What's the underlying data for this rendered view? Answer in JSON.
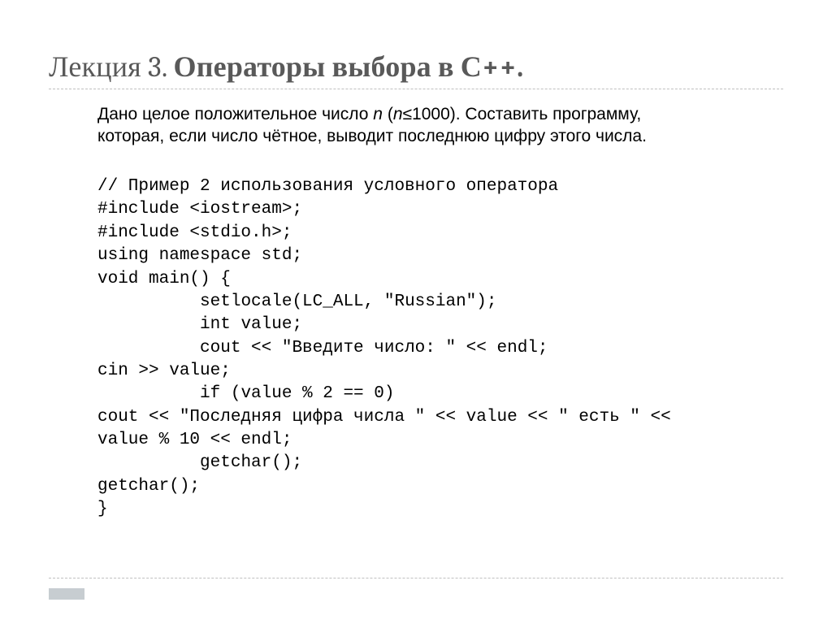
{
  "title": {
    "prefix_light": "Лекция 3. ",
    "main_bold": "Операторы выбора в С++."
  },
  "problem": {
    "line1_a": "Дано целое  положительное число ",
    "line1_var": "n",
    "line1_b": " (",
    "line1_var2": "n",
    "line1_c": "≤1000). Составить программу,",
    "line2": "которая, если число чётное, выводит последнюю цифру этого числа."
  },
  "code_lines": [
    "// Пример 2 использования условного оператора",
    "#include <iostream>;",
    "#include <stdio.h>;",
    "using namespace std;",
    "void main() {",
    "          setlocale(LC_ALL, \"Russian\");",
    "          int value;",
    "          cout << \"Введите число: \" << endl;",
    "cin >> value;",
    "          if (value % 2 == 0)",
    "cout << \"Последняя цифра числа \" << value << \" есть \" <<",
    "value % 10 << endl;",
    "          getchar();",
    "getchar();",
    "}"
  ]
}
